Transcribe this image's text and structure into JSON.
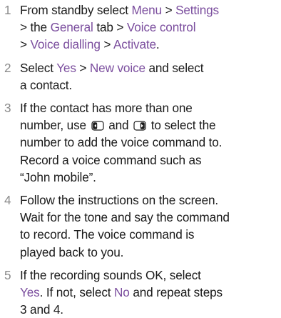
{
  "steps": [
    {
      "number": "1",
      "lines": [
        {
          "pre": "From standby select ",
          "menu": "Menu",
          "gt": " > ",
          "settings": "Settings"
        },
        {
          "gt1": "> the ",
          "general": "General",
          "tab": " tab > ",
          "voice_control": "Voice control"
        },
        {
          "gt": "> ",
          "voice_dialling": "Voice dialling",
          "gt2": " > ",
          "activate": "Activate",
          "end": "."
        }
      ]
    },
    {
      "number": "2",
      "lines": [
        {
          "pre": "Select ",
          "yes": "Yes",
          "gt": " > ",
          "new_voice": "New voice",
          "post": " and select"
        },
        {
          "text": "a contact."
        }
      ]
    },
    {
      "number": "3",
      "lines": [
        {
          "text": "If the contact has more than one"
        },
        {
          "pre": "number, use ",
          "mid": " and ",
          "post": " to select the"
        },
        {
          "text": "number to add the voice command to."
        },
        {
          "text": "Record a voice command such as"
        },
        {
          "text": "“John mobile”."
        }
      ],
      "icons": [
        "left-navigation-key-icon",
        "right-navigation-key-icon"
      ]
    },
    {
      "number": "4",
      "lines": [
        {
          "text": "Follow the instructions on the screen."
        },
        {
          "text": "Wait for the tone and say the command"
        },
        {
          "text": "to record. The voice command is"
        },
        {
          "text": "played back to you."
        }
      ]
    },
    {
      "number": "5",
      "lines": [
        {
          "text": "If the recording sounds OK, select"
        },
        {
          "yes": "Yes",
          "pre": ". If not, select ",
          "no": "No",
          "post": " and repeat steps"
        },
        {
          "text": "3 and 4."
        }
      ]
    }
  ],
  "colors": {
    "highlight": "#7b4e9e",
    "number": "#8a8a8a",
    "text": "#1a1a1a"
  }
}
